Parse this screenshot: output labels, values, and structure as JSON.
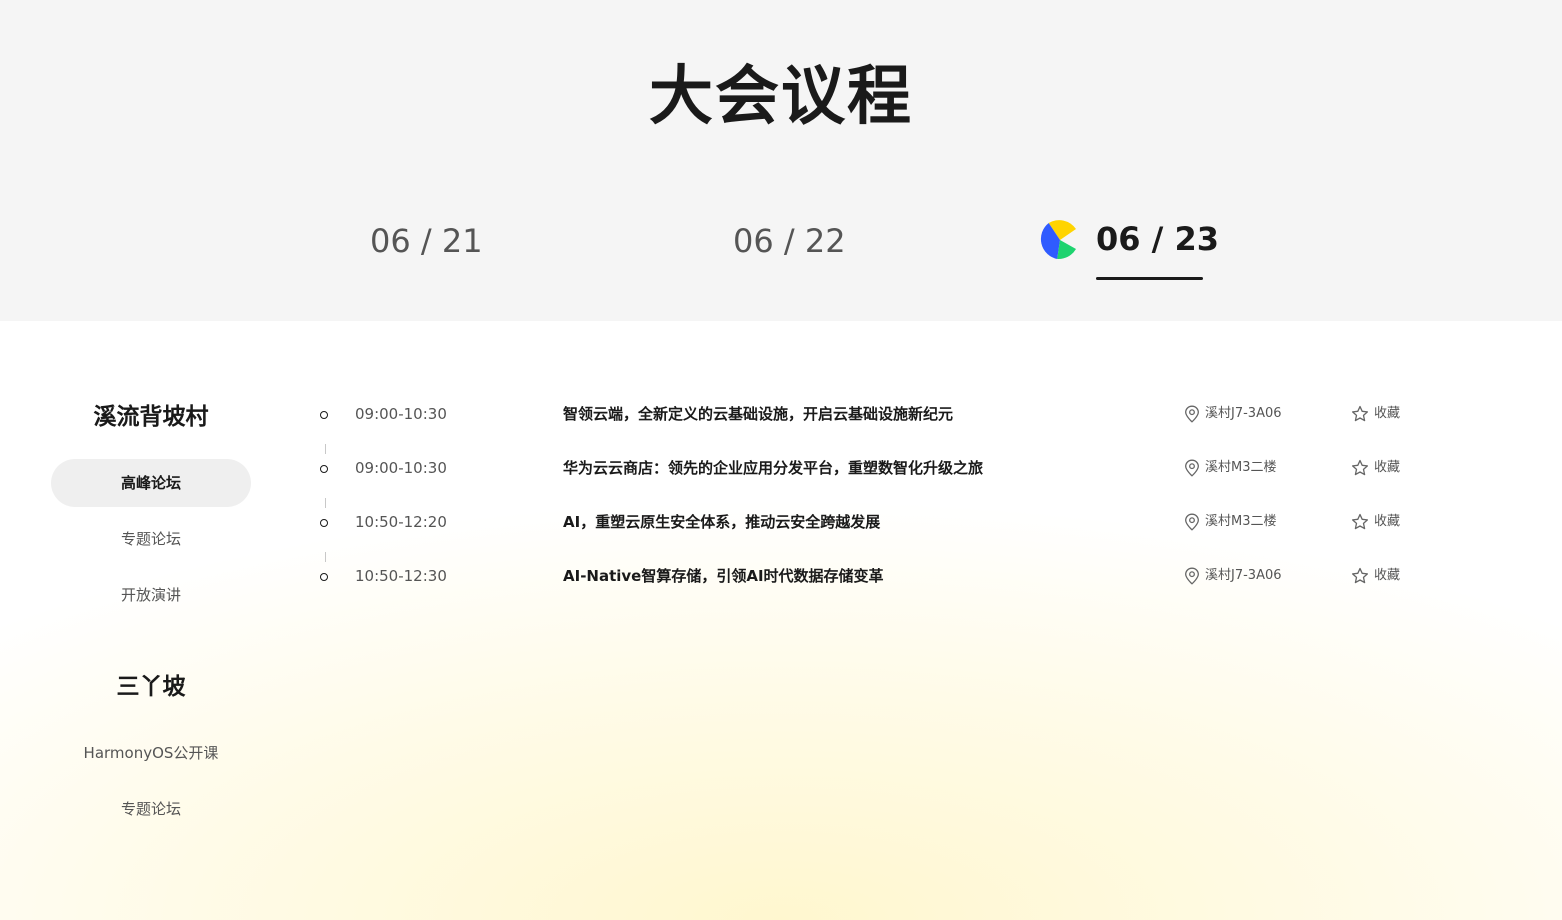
{
  "page": {
    "title": "大会议程"
  },
  "date_tabs": [
    {
      "label": "06 / 21",
      "active": false
    },
    {
      "label": "06 / 22",
      "active": false
    },
    {
      "label": "06 / 23",
      "active": true
    }
  ],
  "brand_colors": {
    "yellow": "#FFD400",
    "blue": "#2F5BFF",
    "green": "#1ED36F"
  },
  "sidebar": {
    "venues": [
      {
        "name": "溪流背坡村",
        "items": [
          {
            "label": "高峰论坛",
            "selected": true
          },
          {
            "label": "专题论坛",
            "selected": false
          },
          {
            "label": "开放演讲",
            "selected": false
          }
        ]
      },
      {
        "name": "三丫坡",
        "items": [
          {
            "label": "HarmonyOS公开课",
            "selected": false
          },
          {
            "label": "专题论坛",
            "selected": false
          }
        ]
      }
    ]
  },
  "agenda": {
    "favorite_label": "收藏",
    "location_icon": "location-pin-icon",
    "favorite_icon": "star-outline-icon",
    "rows": [
      {
        "time": "09:00-10:30",
        "title": "智领云端，全新定义的云基础设施，开启云基础设施新纪元",
        "location": "溪村J7-3A06"
      },
      {
        "time": "09:00-10:30",
        "title": "华为云云商店：领先的企业应用分发平台，重塑数智化升级之旅",
        "location": "溪村M3二楼"
      },
      {
        "time": "10:50-12:20",
        "title": "AI，重塑云原生安全体系，推动云安全跨越发展",
        "location": "溪村M3二楼"
      },
      {
        "time": "10:50-12:30",
        "title": "AI-Native智算存储，引领AI时代数据存储变革",
        "location": "溪村J7-3A06"
      }
    ]
  }
}
